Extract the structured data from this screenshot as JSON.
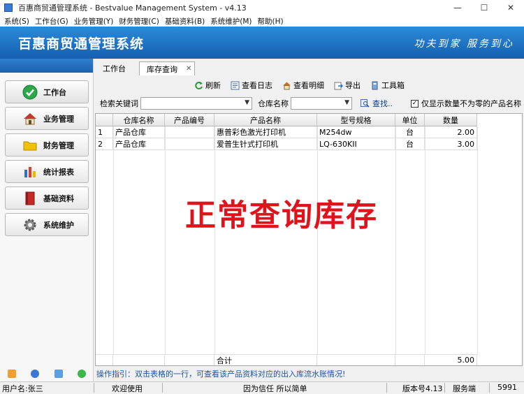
{
  "window": {
    "title": "百惠商贸通管理系统 - Bestvalue Management System - v4.13",
    "controls": {
      "minimize": "—",
      "maximize": "☐",
      "close": "✕"
    }
  },
  "menu": [
    "系统(S)",
    "工作台(G)",
    "业务管理(Y)",
    "财务管理(C)",
    "基础资料(B)",
    "系统维护(M)",
    "帮助(H)"
  ],
  "banner": {
    "title": "百惠商贸通管理系统",
    "slogan": "功夫到家 服务到心"
  },
  "sidebar": {
    "items": [
      {
        "label": "工作台",
        "icon": "check-circle-icon",
        "color": "#2aa84a"
      },
      {
        "label": "业务管理",
        "icon": "house-icon",
        "color": "#c0392b"
      },
      {
        "label": "财务管理",
        "icon": "folder-icon",
        "color": "#e8b800"
      },
      {
        "label": "统计报表",
        "icon": "bar-chart-icon",
        "color": "#2f6fd0"
      },
      {
        "label": "基础资料",
        "icon": "book-icon",
        "color": "#c62828"
      },
      {
        "label": "系统维护",
        "icon": "gear-icon",
        "color": "#808080"
      }
    ],
    "bottom_icons": [
      "edit-icon",
      "clock-icon",
      "search-doc-icon",
      "refresh-icon"
    ]
  },
  "tabs": [
    {
      "label": "工作台"
    },
    {
      "label": "库存查询",
      "close": "✕"
    }
  ],
  "toolbar": {
    "refresh": "刷新",
    "log": "查看日志",
    "detail": "查看明细",
    "export": "导出",
    "tools": "工具箱"
  },
  "search": {
    "keyword_label": "检索关键词",
    "keyword_value": "",
    "warehouse_label": "仓库名称",
    "warehouse_value": "",
    "find_label": "查找..",
    "nonzero_label": "仅显示数量不为零的产品名称",
    "nonzero_checked": true
  },
  "table": {
    "columns": [
      "",
      "仓库名称",
      "产品编号",
      "产品名称",
      "型号规格",
      "单位",
      "数量"
    ],
    "rows": [
      [
        "1",
        "产品仓库",
        "",
        "惠普彩色激光打印机",
        "M254dw",
        "台",
        "2.00"
      ],
      [
        "2",
        "产品仓库",
        "",
        "爱普生针式打印机",
        "LQ-630KII",
        "台",
        "3.00"
      ]
    ],
    "total_label": "合计",
    "total_value": "5.00"
  },
  "overlay_text": "正常查询库存",
  "hint": "操作指引：双击表格的一行，可查看该产品资料对应的出入库流水账情况!",
  "status": {
    "user": "用户名:张三",
    "welcome": "欢迎使用",
    "motto": "因为信任 所以简单",
    "version": "版本号4.13",
    "service_label": "服务端",
    "service_port": "5991"
  }
}
